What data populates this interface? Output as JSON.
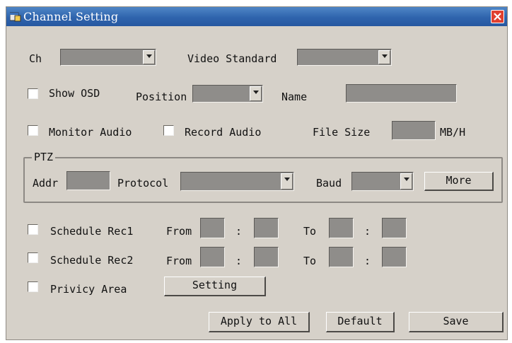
{
  "window": {
    "title": "Channel Setting"
  },
  "row1": {
    "ch_label": "Ch",
    "ch_value": "",
    "video_standard_label": "Video Standard",
    "video_standard_value": ""
  },
  "row2": {
    "show_osd_label": "Show OSD",
    "position_label": "Position",
    "position_value": "",
    "name_label": "Name",
    "name_value": ""
  },
  "row3": {
    "monitor_audio_label": "Monitor Audio",
    "record_audio_label": "Record Audio",
    "file_size_label": "File Size",
    "file_size_value": "",
    "file_size_unit": "MB/H"
  },
  "ptz": {
    "group_label": "PTZ",
    "addr_label": "Addr",
    "addr_value": "",
    "protocol_label": "Protocol",
    "protocol_value": "",
    "baud_label": "Baud",
    "baud_value": "",
    "more_label": "More"
  },
  "schedule1": {
    "label": "Schedule Rec1",
    "from_label": "From",
    "to_label": "To",
    "sep1": ":",
    "sep2": ":"
  },
  "schedule2": {
    "label": "Schedule Rec2",
    "from_label": "From",
    "to_label": "To",
    "sep1": ":",
    "sep2": ":"
  },
  "privacy": {
    "label": "Privicy Area",
    "setting_label": "Setting"
  },
  "footer": {
    "apply_all_label": "Apply to All",
    "default_label": "Default",
    "save_label": "Save"
  },
  "colors": {
    "title_bar": "#2f64ad",
    "dialog_bg": "#d6d1c9",
    "field_bg": "#8f8d8a",
    "close_button": "#e0402f"
  },
  "icons": {
    "app": "app-window-icon",
    "close": "close-icon",
    "dropdown": "chevron-down-icon"
  }
}
